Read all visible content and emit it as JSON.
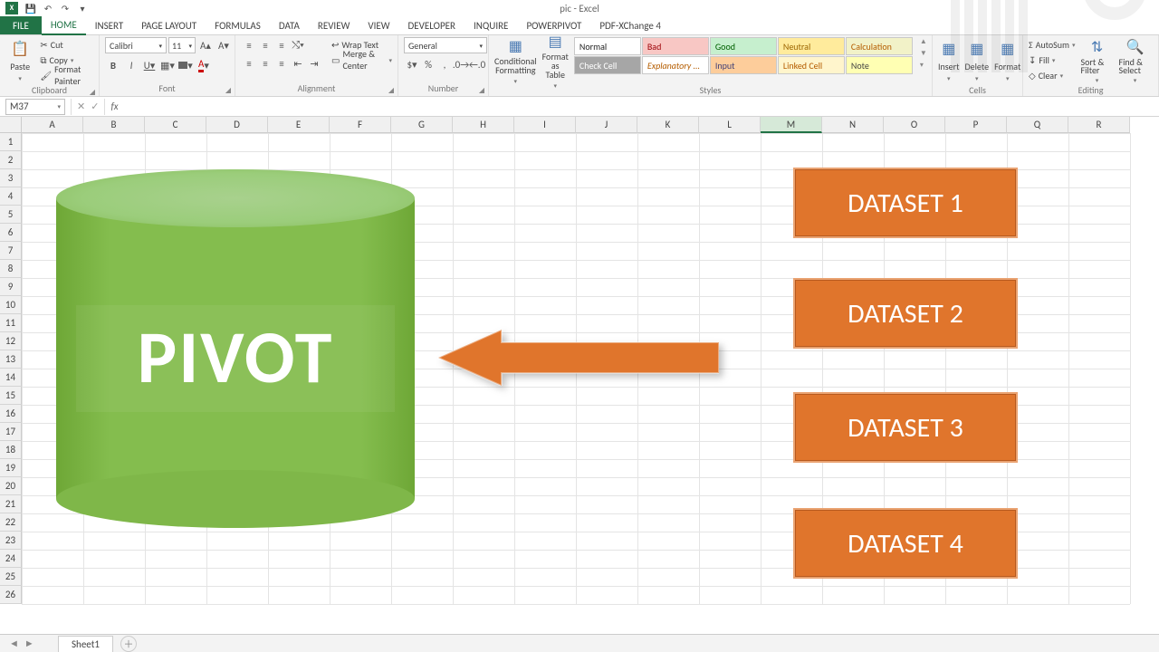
{
  "app": {
    "title": "pic - Excel"
  },
  "qat_icons": [
    "save",
    "undo",
    "redo",
    "customize"
  ],
  "tabs": [
    "FILE",
    "HOME",
    "INSERT",
    "PAGE LAYOUT",
    "FORMULAS",
    "DATA",
    "REVIEW",
    "VIEW",
    "DEVELOPER",
    "INQUIRE",
    "POWERPIVOT",
    "PDF-XChange 4"
  ],
  "active_tab": "HOME",
  "ribbon": {
    "clipboard": {
      "title": "Clipboard",
      "paste": "Paste",
      "cut": "Cut",
      "copy": "Copy",
      "painter": "Format Painter"
    },
    "font": {
      "title": "Font",
      "name": "Calibri",
      "size": "11"
    },
    "alignment": {
      "title": "Alignment",
      "wrap": "Wrap Text",
      "merge": "Merge & Center"
    },
    "number": {
      "title": "Number",
      "format": "General"
    },
    "styles": {
      "title": "Styles",
      "cond": "Conditional Formatting",
      "table": "Format as Table",
      "gallery": [
        "Normal",
        "Bad",
        "Good",
        "Neutral",
        "Calculation",
        "Check Cell",
        "Explanatory ...",
        "Input",
        "Linked Cell",
        "Note"
      ]
    },
    "cells": {
      "title": "Cells",
      "insert": "Insert",
      "delete": "Delete",
      "format": "Format"
    },
    "editing": {
      "title": "Editing",
      "autosum": "AutoSum",
      "fill": "Fill",
      "clear": "Clear",
      "sort": "Sort & Filter",
      "find": "Find & Select"
    }
  },
  "formula_bar": {
    "name_box": "M37",
    "formula": ""
  },
  "columns": [
    "A",
    "B",
    "C",
    "D",
    "E",
    "F",
    "G",
    "H",
    "I",
    "J",
    "K",
    "L",
    "M",
    "N",
    "O",
    "P",
    "Q",
    "R"
  ],
  "active_column": "M",
  "rows": 26,
  "shapes": {
    "cylinder_label": "PIVOT",
    "datasets": [
      "DATASET 1",
      "DATASET 2",
      "DATASET 3",
      "DATASET 4"
    ]
  },
  "sheet_tabs": {
    "active": "Sheet1"
  }
}
